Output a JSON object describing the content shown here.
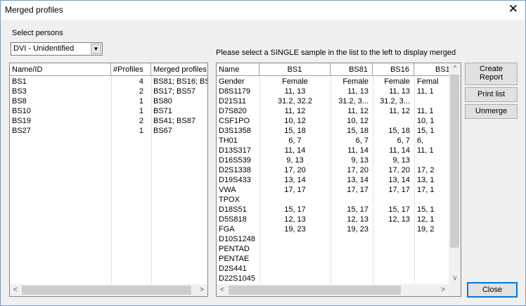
{
  "window": {
    "title": "Merged profiles",
    "close_glyph": "✕"
  },
  "select_persons_label": "Select persons",
  "person_combo": {
    "value": "DVI - Unidentified"
  },
  "instruction": "Please select a SINGLE sample in the list to the left to display merged",
  "left_grid": {
    "headers": [
      "Name/ID",
      "#Profiles",
      "Merged profiles"
    ],
    "rows": [
      [
        "BS1",
        "4",
        "BS81; BS16; BS"
      ],
      [
        "BS3",
        "2",
        "BS17; BS57"
      ],
      [
        "BS8",
        "1",
        "BS80"
      ],
      [
        "BS10",
        "1",
        "BS71"
      ],
      [
        "BS19",
        "2",
        "BS41; BS87"
      ],
      [
        "BS27",
        "1",
        "BS67"
      ]
    ]
  },
  "right_grid": {
    "headers": [
      "Name",
      "BS1",
      "BS81",
      "BS16",
      "BS1"
    ],
    "rows": [
      [
        "Gender",
        "Female",
        "Female",
        "Female",
        "Femal"
      ],
      [
        "D8S1179",
        "11, 13",
        "11, 13",
        "11, 13",
        "11, 1"
      ],
      [
        "D21S11",
        "31.2, 32.2",
        "31.2, 3...",
        "31.2, 3...",
        ""
      ],
      [
        "D7S820",
        "11, 12",
        "11, 12",
        "11, 12",
        "11, 1"
      ],
      [
        "CSF1PO",
        "10, 12",
        "10, 12",
        "",
        "10, 1"
      ],
      [
        "D3S1358",
        "15, 18",
        "15, 18",
        "15, 18",
        "15, 1"
      ],
      [
        "TH01",
        "6, 7",
        "6, 7",
        "6, 7",
        "6,"
      ],
      [
        "D13S317",
        "11, 14",
        "11, 14",
        "11, 14",
        "11, 1"
      ],
      [
        "D16S539",
        "9, 13",
        "9, 13",
        "9, 13",
        ""
      ],
      [
        "D2S1338",
        "17, 20",
        "17, 20",
        "17, 20",
        "17, 2"
      ],
      [
        "D19S433",
        "13, 14",
        "13, 14",
        "13, 14",
        "13, 1"
      ],
      [
        "VWA",
        "17, 17",
        "17, 17",
        "17, 17",
        "17, 1"
      ],
      [
        "TPOX",
        "",
        "",
        "",
        ""
      ],
      [
        "D18S51",
        "15, 17",
        "15, 17",
        "15, 17",
        "15, 1"
      ],
      [
        "D5S818",
        "12, 13",
        "12, 13",
        "12, 13",
        "12, 1"
      ],
      [
        "FGA",
        "19, 23",
        "19, 23",
        "",
        "19, 2"
      ],
      [
        "D10S1248",
        "",
        "",
        "",
        ""
      ],
      [
        "PENTAD",
        "",
        "",
        "",
        ""
      ],
      [
        "PENTAE",
        "",
        "",
        "",
        ""
      ],
      [
        "D2S441",
        "",
        "",
        "",
        ""
      ],
      [
        "D22S1045",
        "",
        "",
        "",
        ""
      ]
    ]
  },
  "buttons": {
    "create_report": [
      "Create",
      "Report"
    ],
    "print_list": "Print list",
    "unmerge": "Unmerge",
    "close": "Close"
  },
  "scroll": {
    "left_arrow": "<",
    "right_arrow": ">",
    "up_arrow": "^",
    "down_arrow": "v"
  }
}
